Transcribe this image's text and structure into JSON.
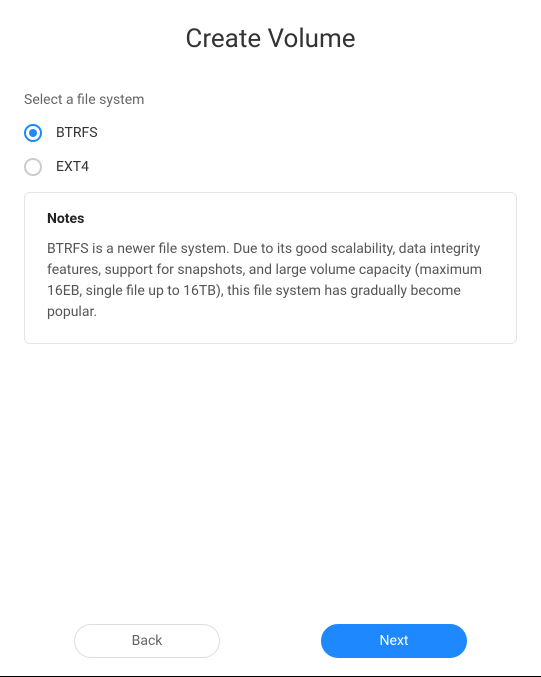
{
  "title": "Create Volume",
  "prompt": "Select a file system",
  "options": [
    {
      "label": "BTRFS",
      "selected": true
    },
    {
      "label": "EXT4",
      "selected": false
    }
  ],
  "notes": {
    "title": "Notes",
    "text": "BTRFS is a newer file system. Due to its good scalability, data integrity features, support for snapshots, and large volume capacity (maximum 16EB, single file up to 16TB), this file system has gradually become popular."
  },
  "buttons": {
    "back": "Back",
    "next": "Next"
  }
}
